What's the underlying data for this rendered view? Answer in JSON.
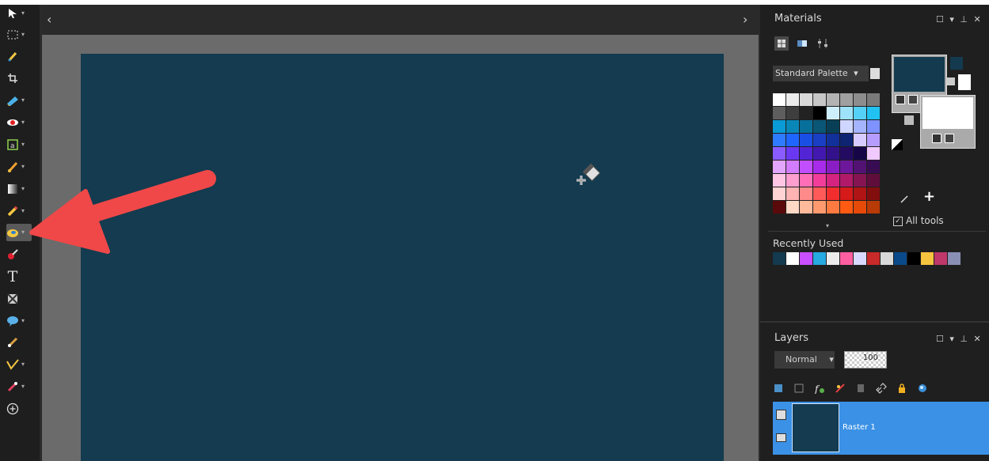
{
  "canvas": {
    "left_chevron": "‹",
    "right_chevron": "›"
  },
  "toolbar": {
    "tools": [
      {
        "name": "pick-tool",
        "icon": "arrow-pointer-icon"
      },
      {
        "name": "selection-tool",
        "icon": "marquee-icon"
      },
      {
        "name": "dropper-tool",
        "icon": "dropper-icon"
      },
      {
        "name": "crop-tool",
        "icon": "crop-icon"
      },
      {
        "name": "straighten-tool",
        "icon": "straighten-icon"
      },
      {
        "name": "red-eye-tool",
        "icon": "eye-icon"
      },
      {
        "name": "text-frame-tool",
        "icon": "frame-icon"
      },
      {
        "name": "paint-brush-tool",
        "icon": "brush-icon"
      },
      {
        "name": "gradient-tool",
        "icon": "gradient-icon"
      },
      {
        "name": "pencil-tool",
        "icon": "pencil-icon"
      },
      {
        "name": "flood-fill-tool",
        "icon": "bucket-icon"
      },
      {
        "name": "color-replacer-tool",
        "icon": "replacer-icon"
      },
      {
        "name": "text-tool",
        "icon": "text-icon"
      },
      {
        "name": "pattern-tool",
        "icon": "pattern-icon"
      },
      {
        "name": "preset-shape-tool",
        "icon": "speech-bubble-icon"
      },
      {
        "name": "clone-brush-tool",
        "icon": "clone-icon"
      },
      {
        "name": "pen-tool",
        "icon": "pen-icon"
      },
      {
        "name": "makeover-tool",
        "icon": "makeover-icon"
      },
      {
        "name": "add-tool",
        "icon": "plus-circle-icon"
      }
    ],
    "text_tool_glyph": "T"
  },
  "materials": {
    "title": "Materials",
    "palette_label": "Standard Palette",
    "all_tools_label": "All tools",
    "recently_used_label": "Recently Used",
    "foreground_color": "#133a4f",
    "background_color": "#ffffff",
    "palette_colors": [
      "#ffffff",
      "#ececec",
      "#d9d9d9",
      "#c6c6c6",
      "#b3b3b3",
      "#a0a0a0",
      "#8d8d8d",
      "#7a7a7a",
      "#5e5e5e",
      "#3e3e3e",
      "#222222",
      "#000000",
      "#cdeffd",
      "#9fe3fb",
      "#55d1f7",
      "#21c2f2",
      "#0a9bd6",
      "#0a87b9",
      "#086f9a",
      "#0a5676",
      "#083f57",
      "#cfd6ff",
      "#a5b4ff",
      "#7e93ff",
      "#2f7bff",
      "#1e66ff",
      "#1a4fe6",
      "#1a3ec4",
      "#12309a",
      "#0e2372",
      "#d7cbff",
      "#b69cff",
      "#8a5cff",
      "#6a38f2",
      "#5224d6",
      "#4218b0",
      "#32118a",
      "#230b62",
      "#160648",
      "#f0c9ff",
      "#e3a6ff",
      "#d27cff",
      "#c24fff",
      "#a72be8",
      "#8a1ec4",
      "#6d179c",
      "#511274",
      "#380c52",
      "#ffc6e4",
      "#ff9fd0",
      "#ff6fb8",
      "#f23d9b",
      "#d42480",
      "#b01a69",
      "#861453",
      "#5f0e3b",
      "#ffd3d3",
      "#ffb3b3",
      "#ff8a8a",
      "#ff5a5a",
      "#f22d2d",
      "#d61a1a",
      "#b01414",
      "#820e0e",
      "#5a0a0a",
      "#ffd8c6",
      "#ffba9c",
      "#ff9a6f",
      "#ff7a40",
      "#ff5a12",
      "#e64a08",
      "#b83a06"
    ],
    "recent_colors": [
      "#133a4f",
      "#ffffff",
      "#c94fff",
      "#27a9e1",
      "#ececec",
      "#ff5fa0",
      "#d9d9ff",
      "#c82a2a",
      "#d9d9d9",
      "#0a4a8a",
      "#000000",
      "#f7c43f",
      "#c0386a",
      "#8a8fb5"
    ]
  },
  "layers": {
    "title": "Layers",
    "blend_mode": "Normal",
    "opacity": "100",
    "layer_name": "Raster 1",
    "layer_color": "#143b4f"
  }
}
